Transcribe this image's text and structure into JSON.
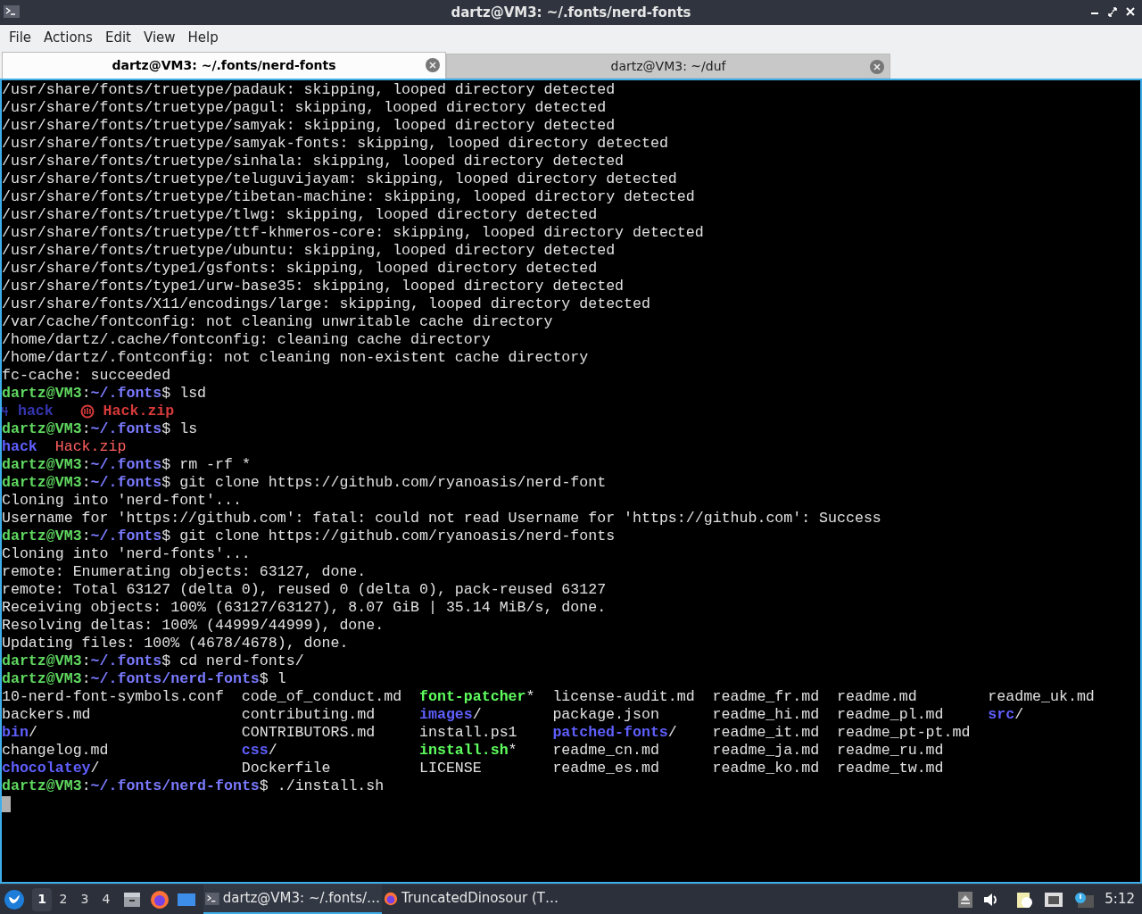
{
  "window": {
    "title": "dartz@VM3: ~/.fonts/nerd-fonts"
  },
  "menu": [
    "File",
    "Actions",
    "Edit",
    "View",
    "Help"
  ],
  "tabs": [
    {
      "label": "dartz@VM3: ~/.fonts/nerd-fonts",
      "selected": true
    },
    {
      "label": "dartz@VM3: ~/duf",
      "selected": false
    }
  ],
  "terminal": {
    "lines": [
      {
        "kind": "output",
        "text": "/usr/share/fonts/truetype/padauk: skipping, looped directory detected"
      },
      {
        "kind": "output",
        "text": "/usr/share/fonts/truetype/pagul: skipping, looped directory detected"
      },
      {
        "kind": "output",
        "text": "/usr/share/fonts/truetype/samyak: skipping, looped directory detected"
      },
      {
        "kind": "output",
        "text": "/usr/share/fonts/truetype/samyak-fonts: skipping, looped directory detected"
      },
      {
        "kind": "output",
        "text": "/usr/share/fonts/truetype/sinhala: skipping, looped directory detected"
      },
      {
        "kind": "output",
        "text": "/usr/share/fonts/truetype/teluguvijayam: skipping, looped directory detected"
      },
      {
        "kind": "output",
        "text": "/usr/share/fonts/truetype/tibetan-machine: skipping, looped directory detected"
      },
      {
        "kind": "output",
        "text": "/usr/share/fonts/truetype/tlwg: skipping, looped directory detected"
      },
      {
        "kind": "output",
        "text": "/usr/share/fonts/truetype/ttf-khmeros-core: skipping, looped directory detected"
      },
      {
        "kind": "output",
        "text": "/usr/share/fonts/truetype/ubuntu: skipping, looped directory detected"
      },
      {
        "kind": "output",
        "text": "/usr/share/fonts/type1/gsfonts: skipping, looped directory detected"
      },
      {
        "kind": "output",
        "text": "/usr/share/fonts/type1/urw-base35: skipping, looped directory detected"
      },
      {
        "kind": "output",
        "text": "/usr/share/fonts/X11/encodings/large: skipping, looped directory detected"
      },
      {
        "kind": "output",
        "text": "/var/cache/fontconfig: not cleaning unwritable cache directory"
      },
      {
        "kind": "output",
        "text": "/home/dartz/.cache/fontconfig: cleaning cache directory"
      },
      {
        "kind": "output",
        "text": "/home/dartz/.fontconfig: not cleaning non-existent cache directory"
      },
      {
        "kind": "output",
        "text": "fc-cache: succeeded"
      },
      {
        "kind": "prompt",
        "user": "dartz@VM3",
        "separator": ":",
        "path": "~/.fonts",
        "symbol": "$",
        "command": "lsd"
      },
      {
        "kind": "icons",
        "entries": [
          {
            "text": "hack",
            "kind": "dir"
          },
          {
            "text": "Hack.zip",
            "kind": "archive"
          }
        ]
      },
      {
        "kind": "prompt",
        "user": "dartz@VM3",
        "separator": ":",
        "path": "~/.fonts",
        "symbol": "$",
        "command": "ls"
      },
      {
        "kind": "files",
        "entries": [
          {
            "text": "hack",
            "kind": "dir"
          },
          {
            "text": "Hack.zip",
            "kind": "archive"
          }
        ]
      },
      {
        "kind": "prompt",
        "user": "dartz@VM3",
        "separator": ":",
        "path": "~/.fonts",
        "symbol": "$",
        "command": "rm -rf *"
      },
      {
        "kind": "prompt",
        "user": "dartz@VM3",
        "separator": ":",
        "path": "~/.fonts",
        "symbol": "$",
        "command": "git clone https://github.com/ryanoasis/nerd-font"
      },
      {
        "kind": "output",
        "text": "Cloning into 'nerd-font'..."
      },
      {
        "kind": "output",
        "text": "Username for 'https://github.com': fatal: could not read Username for 'https://github.com': Success"
      },
      {
        "kind": "prompt",
        "user": "dartz@VM3",
        "separator": ":",
        "path": "~/.fonts",
        "symbol": "$",
        "command": "git clone https://github.com/ryanoasis/nerd-fonts"
      },
      {
        "kind": "output",
        "text": "Cloning into 'nerd-fonts'..."
      },
      {
        "kind": "output",
        "text": "remote: Enumerating objects: 63127, done."
      },
      {
        "kind": "output",
        "text": "remote: Total 63127 (delta 0), reused 0 (delta 0), pack-reused 63127"
      },
      {
        "kind": "output",
        "text": "Receiving objects: 100% (63127/63127), 8.07 GiB | 35.14 MiB/s, done."
      },
      {
        "kind": "output",
        "text": "Resolving deltas: 100% (44999/44999), done."
      },
      {
        "kind": "output",
        "text": "Updating files: 100% (4678/4678), done."
      },
      {
        "kind": "prompt",
        "user": "dartz@VM3",
        "separator": ":",
        "path": "~/.fonts",
        "symbol": "$",
        "command": "cd nerd-fonts/"
      },
      {
        "kind": "prompt",
        "user": "dartz@VM3",
        "separator": ":",
        "path": "~/.fonts/nerd-fonts",
        "symbol": "$",
        "command": "l"
      },
      {
        "kind": "grid",
        "rows": [
          [
            {
              "text": "10-nerd-font-symbols.conf",
              "kind": "file"
            },
            {
              "text": "code_of_conduct.md",
              "kind": "file"
            },
            {
              "text": "font-patcher",
              "suffix": "*",
              "kind": "exec"
            },
            {
              "text": "license-audit.md",
              "kind": "file"
            },
            {
              "text": "readme_fr.md",
              "kind": "file"
            },
            {
              "text": "readme.md",
              "kind": "file"
            },
            {
              "text": "readme_uk.md",
              "kind": "file"
            }
          ],
          [
            {
              "text": "backers.md",
              "kind": "file"
            },
            {
              "text": "contributing.md",
              "kind": "file"
            },
            {
              "text": "images",
              "suffix": "/",
              "kind": "dir"
            },
            {
              "text": "package.json",
              "kind": "file"
            },
            {
              "text": "readme_hi.md",
              "kind": "file"
            },
            {
              "text": "readme_pl.md",
              "kind": "file"
            },
            {
              "text": "src",
              "suffix": "/",
              "kind": "dir"
            }
          ],
          [
            {
              "text": "bin",
              "suffix": "/",
              "kind": "dir"
            },
            {
              "text": "CONTRIBUTORS.md",
              "kind": "file"
            },
            {
              "text": "install.ps1",
              "kind": "file"
            },
            {
              "text": "patched-fonts",
              "suffix": "/",
              "kind": "dir"
            },
            {
              "text": "readme_it.md",
              "kind": "file"
            },
            {
              "text": "readme_pt-pt.md",
              "kind": "file"
            }
          ],
          [
            {
              "text": "changelog.md",
              "kind": "file"
            },
            {
              "text": "css",
              "suffix": "/",
              "kind": "dir"
            },
            {
              "text": "install.sh",
              "suffix": "*",
              "kind": "exec"
            },
            {
              "text": "readme_cn.md",
              "kind": "file"
            },
            {
              "text": "readme_ja.md",
              "kind": "file"
            },
            {
              "text": "readme_ru.md",
              "kind": "file"
            }
          ],
          [
            {
              "text": "chocolatey",
              "suffix": "/",
              "kind": "dir"
            },
            {
              "text": "Dockerfile",
              "kind": "file"
            },
            {
              "text": "LICENSE",
              "kind": "file"
            },
            {
              "text": "readme_es.md",
              "kind": "file"
            },
            {
              "text": "readme_ko.md",
              "kind": "file"
            },
            {
              "text": "readme_tw.md",
              "kind": "file"
            }
          ]
        ]
      },
      {
        "kind": "prompt",
        "user": "dartz@VM3",
        "separator": ":",
        "path": "~/.fonts/nerd-fonts",
        "symbol": "$",
        "command": "./install.sh"
      },
      {
        "kind": "cursor"
      }
    ]
  },
  "taskbar": {
    "workspaces": [
      {
        "label": "1",
        "selected": true
      },
      {
        "label": "2",
        "selected": false
      },
      {
        "label": "3",
        "selected": false
      },
      {
        "label": "4",
        "selected": false
      }
    ],
    "tasks": [
      {
        "label": "dartz@VM3: ~/.fonts/…",
        "kind": "terminal",
        "selected": true
      },
      {
        "label": "TruncatedDinosour (T…",
        "kind": "browser",
        "selected": false
      }
    ],
    "clock": "5:12"
  }
}
